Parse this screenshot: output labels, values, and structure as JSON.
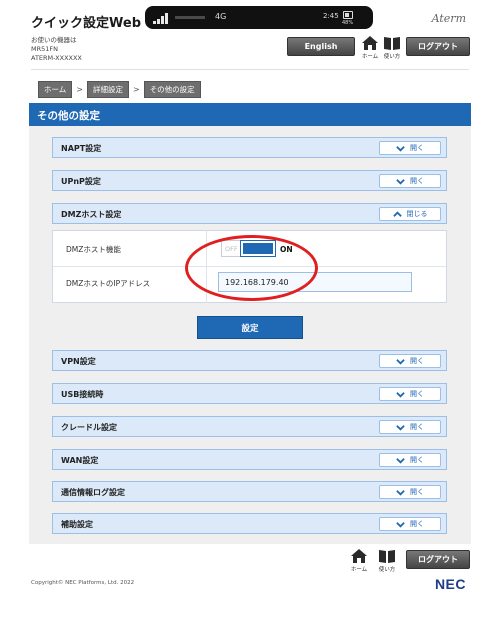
{
  "header": {
    "app_title": "クイック設定Web",
    "device_caption": "お使いの機器は",
    "device_model": "MR51FN",
    "device_id": "ATERM-XXXXXX",
    "brand": "Aterm",
    "network_type": "4G",
    "clock": "2:45",
    "battery_percent": "48%",
    "english_label": "English",
    "home_label": "ホーム",
    "help_label": "使い方",
    "logout_label": "ログアウト"
  },
  "breadcrumb": [
    {
      "label": "ホーム"
    },
    {
      "label": "詳細設定"
    },
    {
      "label": "その他の設定"
    }
  ],
  "breadcrumb_separator": ">",
  "page_title": "その他の設定",
  "accordion": {
    "open_label": "開く",
    "close_label": "閉じる",
    "items": [
      {
        "label": "NAPT設定"
      },
      {
        "label": "UPnP設定"
      },
      {
        "label": "DMZホスト設定"
      },
      {
        "label": "VPN設定"
      },
      {
        "label": "USB接続時"
      },
      {
        "label": "クレードル設定"
      },
      {
        "label": "WAN設定"
      },
      {
        "label": "通信情報ログ設定"
      },
      {
        "label": "補助設定"
      }
    ]
  },
  "dmz": {
    "function_label": "DMZホスト機能",
    "toggle_off_label": "OFF",
    "toggle_on_label": "ON",
    "toggle_state": "ON",
    "ip_label": "DMZホストのIPアドレス",
    "ip_value": "192.168.179.40"
  },
  "apply_label": "設定",
  "footer": {
    "copyright": "Copyright© NEC Platforms, Ltd. 2022",
    "home_label": "ホーム",
    "help_label": "使い方",
    "logout_label": "ログアウト",
    "logo": "NEC"
  },
  "colors": {
    "accent": "#1f68b4",
    "accordion_bg": "#dbe9f9",
    "highlight_ring": "#e02020"
  },
  "icons": {
    "home": "home-icon",
    "help": "book-icon",
    "chevron_down": "chevron-down-icon",
    "chevron_up": "chevron-up-icon",
    "signal": "signal-icon",
    "battery": "battery-icon"
  }
}
